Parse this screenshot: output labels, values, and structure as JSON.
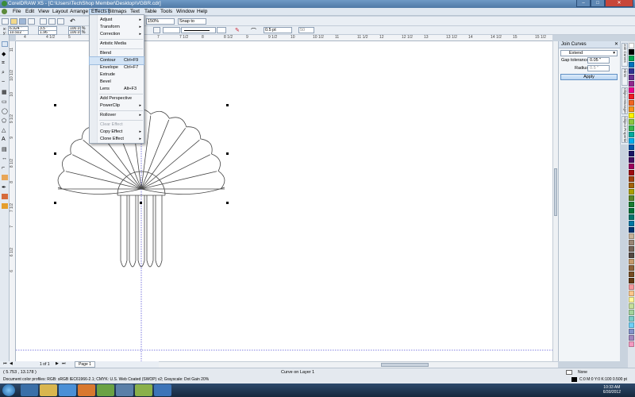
{
  "window": {
    "title": "CorelDRAW X5 - [C:\\Users\\TechShop Member\\Desktop\\VGBR.cdr]",
    "buttons": [
      "–",
      "□",
      "✕"
    ]
  },
  "menubar": [
    "File",
    "Edit",
    "View",
    "Layout",
    "Arrange",
    "Effects",
    "Bitmaps",
    "Text",
    "Table",
    "Tools",
    "Window",
    "Help"
  ],
  "menubar_active": "Effects",
  "toolbar": {
    "zoom": "150%",
    "snap": "Snap to"
  },
  "propbar": {
    "x_label": "x:",
    "x_value": "6.924 \"",
    "y_label": "y:",
    "y_value": "10.922 \"",
    "w_value": "3.5 \"",
    "h_value": "1.96 \"",
    "sx_value": "100.0",
    "sy_value": "100.0",
    "pct": "%",
    "rotation": "0.0",
    "outline_width": "0.5 pt",
    "smoothing": "50"
  },
  "ruler": {
    "units": "inches",
    "h_ticks": [
      "4",
      "4 1/2",
      "5",
      "5 1/2",
      "6",
      "6 1/2",
      "7",
      "7 1/2",
      "8",
      "8 1/2",
      "9",
      "9 1/2",
      "10",
      "10 1/2",
      "11",
      "11 1/2",
      "12",
      "12 1/2",
      "13",
      "13 1/2",
      "14",
      "14 1/2",
      "15",
      "15 1/2"
    ],
    "v_ticks": [
      "11",
      "10 1/2",
      "10",
      "9 1/2",
      "9",
      "8 1/2",
      "8",
      "7 1/2",
      "7",
      "6 1/2",
      "6"
    ]
  },
  "effects_menu": {
    "items": [
      {
        "label": "Adjust",
        "sub": true,
        "name": "menu-adjust"
      },
      {
        "label": "Transform",
        "sub": true,
        "name": "menu-transform"
      },
      {
        "label": "Correction",
        "sub": true,
        "name": "menu-correction"
      },
      {
        "sep": true
      },
      {
        "label": "Artistic Media",
        "name": "menu-artistic-media"
      },
      {
        "sep": true
      },
      {
        "label": "Blend",
        "name": "menu-blend"
      },
      {
        "label": "Contour",
        "shortcut": "Ctrl+F9",
        "selected": true,
        "name": "menu-contour"
      },
      {
        "label": "Envelope",
        "shortcut": "Ctrl+F7",
        "name": "menu-envelope"
      },
      {
        "label": "Extrude",
        "name": "menu-extrude"
      },
      {
        "label": "Bevel",
        "name": "menu-bevel"
      },
      {
        "label": "Lens",
        "shortcut": "Alt+F3",
        "name": "menu-lens"
      },
      {
        "sep": true
      },
      {
        "label": "Add Perspective",
        "name": "menu-add-perspective"
      },
      {
        "label": "PowerClip",
        "sub": true,
        "name": "menu-powerclip"
      },
      {
        "sep": true
      },
      {
        "label": "Rollover",
        "sub": true,
        "name": "menu-rollover"
      },
      {
        "sep": true
      },
      {
        "label": "Clear Effect",
        "disabled": true,
        "name": "menu-clear-effect"
      },
      {
        "label": "Copy Effect",
        "sub": true,
        "name": "menu-copy-effect"
      },
      {
        "label": "Clone Effect",
        "sub": true,
        "name": "menu-clone-effect"
      }
    ]
  },
  "docker": {
    "title": "Join Curves",
    "mode": "Extend",
    "gap_label": "Gap tolerance:",
    "gap_value": "0.05 \"",
    "radius_label": "Radius:",
    "radius_value": "0.5 \"",
    "apply_label": "Apply",
    "tabs": [
      "Join Curves",
      "Hints",
      "Object Manager",
      "Object Properties"
    ]
  },
  "page_nav": {
    "counter": "1 of 1",
    "tab": "Page 1"
  },
  "status": {
    "coords": "( 5.753 , 13.178 )",
    "object": "Curve on Layer 1",
    "profile": "Document color profiles: RGB: sRGB IEC61966-2.1; CMYK: U.S. Web Coated (SWOP) v2; Grayscale: Dot Gain 20%",
    "fill": "None",
    "outline": "C:0 M:0 Y:0 K:100  0.500 pt"
  },
  "taskbar": {
    "time": "10:33 AM",
    "date": "6/30/2012"
  },
  "palette": [
    "#ffffff",
    "#000000",
    "#00a651",
    "#0072bc",
    "#2e3192",
    "#662d91",
    "#92278f",
    "#ec008c",
    "#ed1c24",
    "#f26522",
    "#f7941d",
    "#fff200",
    "#8dc63f",
    "#39b54a",
    "#00a99d",
    "#00aeef",
    "#0054a6",
    "#1b1464",
    "#440e62",
    "#9e005d",
    "#9e0b0f",
    "#a0410d",
    "#a36209",
    "#aba000",
    "#598527",
    "#197b30",
    "#007236",
    "#00746b",
    "#0076a3",
    "#003471",
    "#c7b299",
    "#998675",
    "#736357",
    "#534741",
    "#c69c6d",
    "#8c6239",
    "#754c24",
    "#603913",
    "#f5989d",
    "#fdc68a",
    "#fff799",
    "#c4df9b",
    "#a3d39c",
    "#7accc8",
    "#6dcff6",
    "#8393ca",
    "#a186be",
    "#f49ac1"
  ]
}
